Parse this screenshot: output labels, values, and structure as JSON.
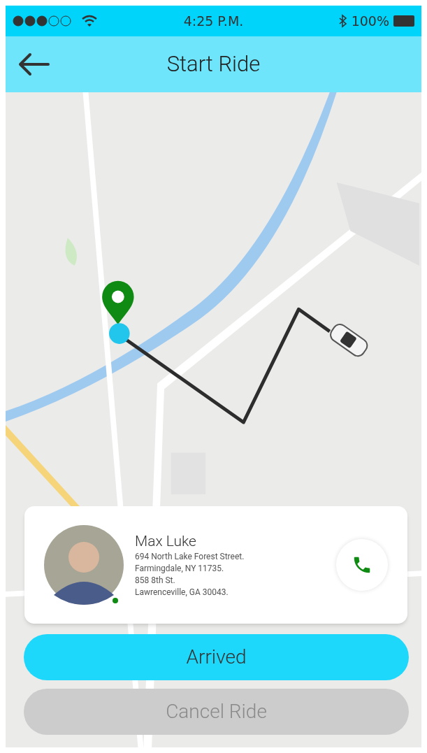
{
  "status_bar": {
    "time": "4:25 P.M.",
    "battery": "100%"
  },
  "header": {
    "title": "Start Ride"
  },
  "rider": {
    "name": "Max Luke",
    "online": true,
    "address_lines": [
      "694 North Lake Forest Street.",
      "Farmingdale, NY 11735.",
      "858 8th St.",
      "Lawrenceville, GA 30043."
    ]
  },
  "buttons": [
    {
      "label": "Arrived",
      "disabled": false
    },
    {
      "label": "Cancel Ride",
      "disabled": true
    }
  ]
}
